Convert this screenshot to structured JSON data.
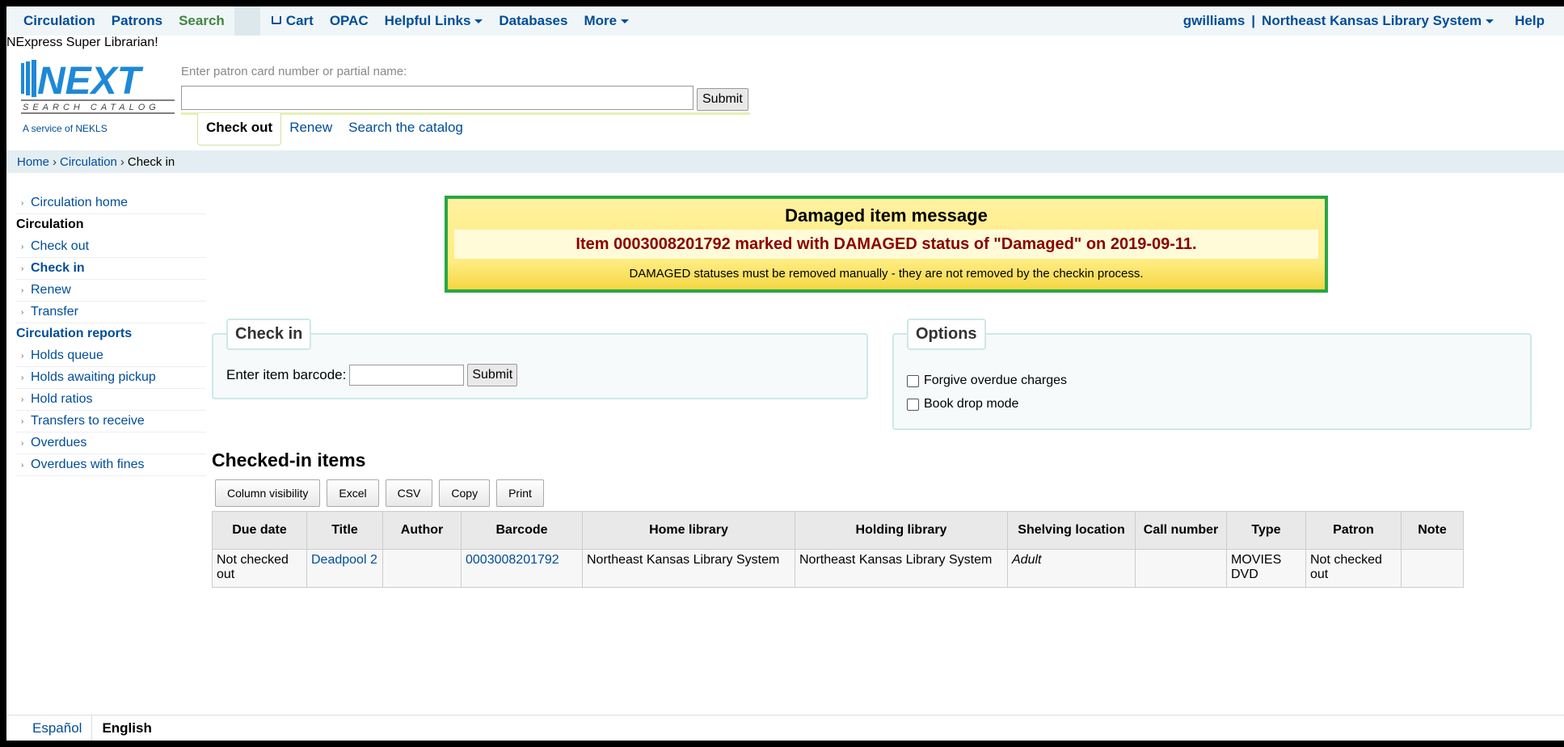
{
  "topnav": {
    "left": [
      {
        "label": "Circulation",
        "caret": false
      },
      {
        "label": "Patrons",
        "caret": false
      },
      {
        "label": "Search",
        "caret": false
      }
    ],
    "cart_label": "Cart",
    "more_left": [
      {
        "label": "OPAC"
      },
      {
        "label": "Helpful Links"
      },
      {
        "label": "Databases"
      },
      {
        "label": "More"
      }
    ],
    "user": "gwilliams",
    "separator": "|",
    "library": "Northeast Kansas Library System",
    "help": "Help"
  },
  "user_title": "NExpress Super Librarian!",
  "logo": {
    "word": "NEXT",
    "sub": "SEARCH CATALOG",
    "service": "A service of NEKLS"
  },
  "patron_search": {
    "label": "Enter patron card number or partial name:",
    "value": "",
    "submit": "Submit"
  },
  "circ_tabs": [
    {
      "label": "Check out",
      "active": true
    },
    {
      "label": "Renew",
      "active": false
    },
    {
      "label": "Search the catalog",
      "active": false
    }
  ],
  "breadcrumb": {
    "home": "Home",
    "sep": "›",
    "circulation": "Circulation",
    "current": "Check in"
  },
  "sidebar": {
    "circ_home": "Circulation home",
    "heading_circulation": "Circulation",
    "circ_items": [
      "Check out",
      "Check in",
      "Renew",
      "Transfer"
    ],
    "heading_reports": "Circulation reports",
    "report_items": [
      "Holds queue",
      "Holds awaiting pickup",
      "Hold ratios",
      "Transfers to receive",
      "Overdues",
      "Overdues with fines"
    ]
  },
  "alert": {
    "title": "Damaged item message",
    "message": "Item 0003008201792 marked with DAMAGED status of \"Damaged\" on 2019-09-11.",
    "note": "DAMAGED statuses must be removed manually - they are not removed by the checkin process."
  },
  "checkin": {
    "legend": "Check in",
    "label": "Enter item barcode:",
    "value": "",
    "submit": "Submit"
  },
  "options": {
    "legend": "Options",
    "forgive": "Forgive overdue charges",
    "bookdrop": "Book drop mode"
  },
  "checked_in": {
    "title": "Checked-in items",
    "buttons": [
      "Column visibility",
      "Excel",
      "CSV",
      "Copy",
      "Print"
    ],
    "columns": [
      "Due date",
      "Title",
      "Author",
      "Barcode",
      "Home library",
      "Holding library",
      "Shelving location",
      "Call number",
      "Type",
      "Patron",
      "Note"
    ],
    "rows": [
      {
        "due": "Not checked out",
        "title": "Deadpool 2",
        "author": "",
        "barcode": "0003008201792",
        "home": "Northeast Kansas Library System",
        "holding": "Northeast Kansas Library System",
        "location": "Adult",
        "call": "",
        "type": "MOVIES DVD",
        "patron": "Not checked out",
        "note": ""
      }
    ]
  },
  "footer": {
    "languages": [
      "Español",
      "English"
    ],
    "current": "English"
  },
  "colors": {
    "link": "#004d99",
    "search": "#408540",
    "alert_border": "#28a745",
    "alert_text": "#8b0000"
  }
}
